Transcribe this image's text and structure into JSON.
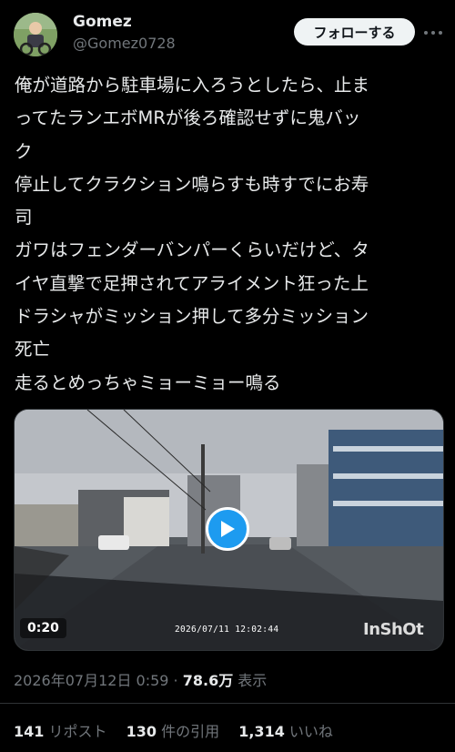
{
  "author": {
    "display_name": "Gomez",
    "handle": "@Gomez0728"
  },
  "follow_button_label": "フォローする",
  "tweet_lines": [
    "俺が道路から駐車場に入ろうとしたら、止ま",
    "ってたランエボMRが後ろ確認せずに鬼バッ",
    "ク",
    "停止してクラクション鳴らすも時すでにお寿",
    "司",
    "ガワはフェンダーバンパーくらいだけど、タ",
    "イヤ直撃で足押されてアライメント狂った上",
    "ドラシャがミッション押して多分ミッション",
    "死亡",
    "走るとめっちゃミョーミョー鳴る"
  ],
  "video": {
    "duration": "0:20",
    "timestamp_overlay": "2026/07/11  12:02:44",
    "watermark": "InShOt"
  },
  "meta": {
    "posted": "2026年07月12日 0:59",
    "separator": " · ",
    "views_count": "78.6万",
    "views_label": " 表示"
  },
  "stats": {
    "reposts_count": "141",
    "reposts_label": "リポスト",
    "quotes_count": "130",
    "quotes_label": "件の引用",
    "likes_count": "1,314",
    "likes_label": "いいね"
  },
  "colors": {
    "background": "#000000",
    "text": "#e7e9ea",
    "secondary": "#71767b",
    "accent": "#1d9bf0"
  },
  "icons": [
    "more-icon",
    "play-icon",
    "avatar"
  ]
}
